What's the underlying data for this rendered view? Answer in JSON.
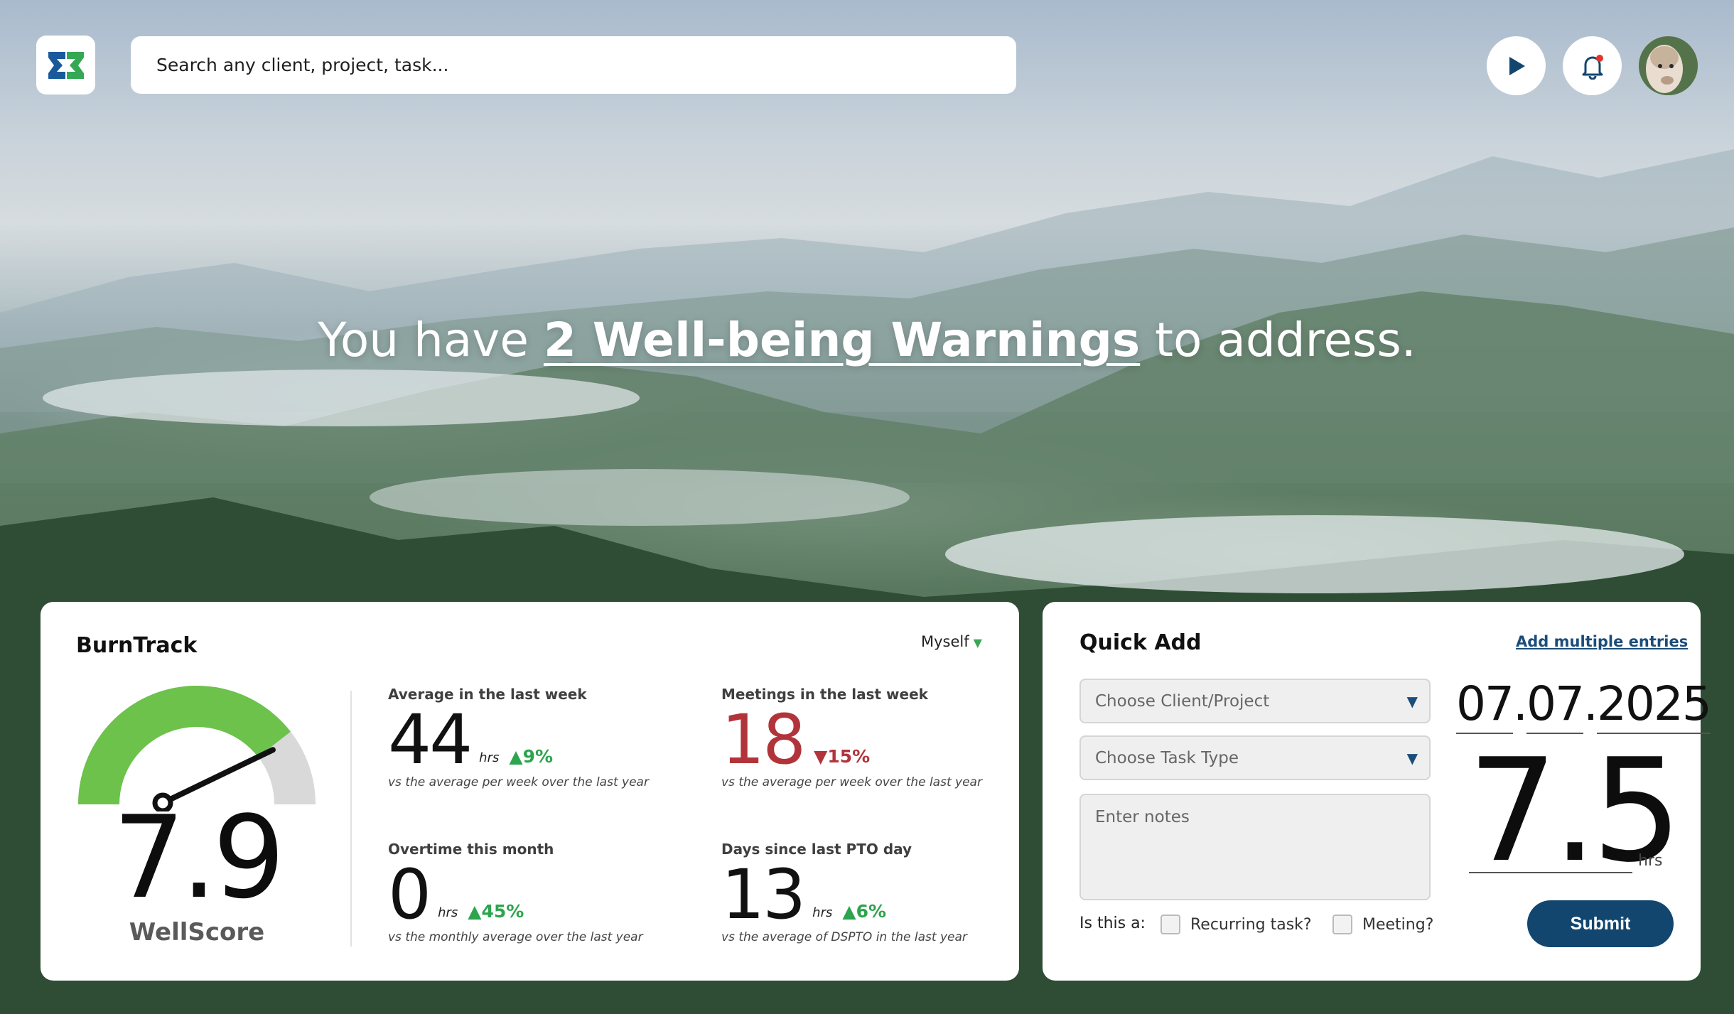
{
  "app": {
    "logo_icon": "app-logo-icon",
    "brand_colors": {
      "green": "#35a853",
      "blue": "#1a5a9c",
      "navy": "#12466f"
    }
  },
  "header": {
    "search_placeholder": "Search any client, project, task...",
    "play_icon": "play-icon",
    "bell_icon": "bell-icon",
    "avatar_icon": "avatar"
  },
  "hero": {
    "prefix": "You have ",
    "warning_link": "2 Well-being Warnings",
    "suffix": " to address."
  },
  "burntrack": {
    "title": "BurnTrack",
    "filter": "Myself",
    "gauge": {
      "value": 7.9,
      "max": 10
    },
    "score": "7.9",
    "score_label": "WellScore",
    "stats": [
      {
        "label": "Average in the last week",
        "value": "44",
        "unit": "hrs",
        "delta": "9%",
        "direction": "up",
        "note": "vs the average per week over the last year"
      },
      {
        "label": "Meetings in the last week",
        "value": "18",
        "unit": "",
        "delta": "15%",
        "direction": "down",
        "note": "vs the average per week over the last year"
      },
      {
        "label": "Overtime this month",
        "value": "0",
        "unit": "hrs",
        "delta": "45%",
        "direction": "up",
        "note": "vs the monthly average over the last year"
      },
      {
        "label": "Days since last PTO day",
        "value": "13",
        "unit": "hrs",
        "delta": "6%",
        "direction": "up",
        "note": "vs the average of DSPTO in the last year"
      }
    ]
  },
  "quick_add": {
    "title": "Quick Add",
    "add_multiple": "Add multiple entries",
    "client_placeholder": "Choose Client/Project",
    "task_placeholder": "Choose Task Type",
    "notes_placeholder": "Enter notes",
    "date": {
      "day": "07",
      "month": "07",
      "year": "2025",
      "sep": "."
    },
    "hours": "7.5",
    "hours_unit": "hrs",
    "is_this": "Is this a:",
    "recurring_label": "Recurring task?",
    "meeting_label": "Meeting?",
    "submit": "Submit"
  }
}
